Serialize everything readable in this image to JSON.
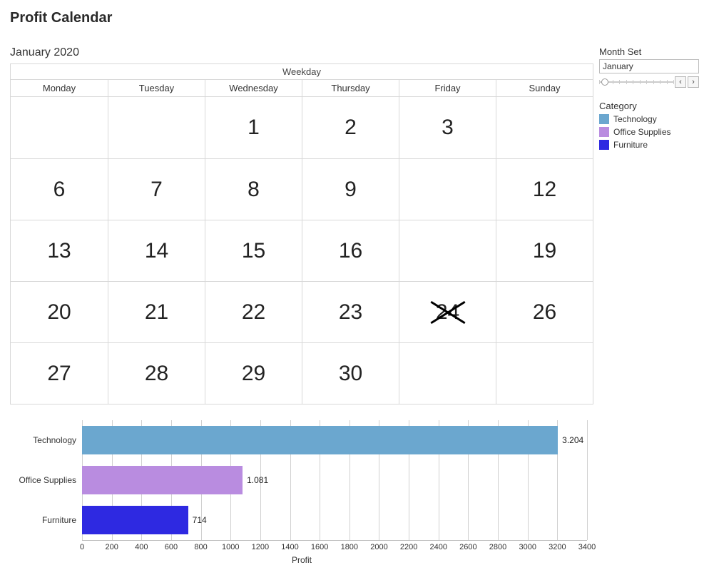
{
  "title": "Profit Calendar",
  "subtitle": "January 2020",
  "calendar": {
    "header": "Weekday",
    "days": [
      "Monday",
      "Tuesday",
      "Wednesday",
      "Thursday",
      "Friday",
      "Sunday"
    ],
    "weeks": [
      [
        {
          "d": ""
        },
        {
          "d": ""
        },
        {
          "d": "1"
        },
        {
          "d": "2"
        },
        {
          "d": "3"
        },
        {
          "d": ""
        }
      ],
      [
        {
          "d": "6"
        },
        {
          "d": "7"
        },
        {
          "d": "8"
        },
        {
          "d": "9"
        },
        {
          "d": ""
        },
        {
          "d": "12"
        }
      ],
      [
        {
          "d": "13"
        },
        {
          "d": "14"
        },
        {
          "d": "15"
        },
        {
          "d": "16"
        },
        {
          "d": ""
        },
        {
          "d": "19"
        }
      ],
      [
        {
          "d": "20"
        },
        {
          "d": "21"
        },
        {
          "d": "22"
        },
        {
          "d": "23"
        },
        {
          "d": "24",
          "x": true
        },
        {
          "d": "26"
        }
      ],
      [
        {
          "d": "27"
        },
        {
          "d": "28"
        },
        {
          "d": "29"
        },
        {
          "d": "30"
        },
        {
          "d": ""
        },
        {
          "d": ""
        }
      ]
    ]
  },
  "chart_data": {
    "type": "bar",
    "title": "",
    "xlabel": "Profit",
    "ylabel": "",
    "xlim": [
      0,
      3400
    ],
    "ticks": [
      0,
      200,
      400,
      600,
      800,
      1000,
      1200,
      1400,
      1600,
      1800,
      2000,
      2200,
      2400,
      2600,
      2800,
      3000,
      3200,
      3400
    ],
    "categories": [
      "Technology",
      "Office Supplies",
      "Furniture"
    ],
    "series": [
      {
        "name": "Technology",
        "value": 3204,
        "label": "3.204",
        "color": "#6ba7cf"
      },
      {
        "name": "Office Supplies",
        "value": 1081,
        "label": "1.081",
        "color": "#b98ce0"
      },
      {
        "name": "Furniture",
        "value": 714,
        "label": "714",
        "color": "#2e29e1"
      }
    ]
  },
  "filter": {
    "title": "Month Set",
    "value": "January",
    "prev": "‹",
    "next": "›"
  },
  "legend": {
    "title": "Category",
    "items": [
      {
        "label": "Technology",
        "color": "#6ba7cf"
      },
      {
        "label": "Office Supplies",
        "color": "#b98ce0"
      },
      {
        "label": "Furniture",
        "color": "#2e29e1"
      }
    ]
  }
}
